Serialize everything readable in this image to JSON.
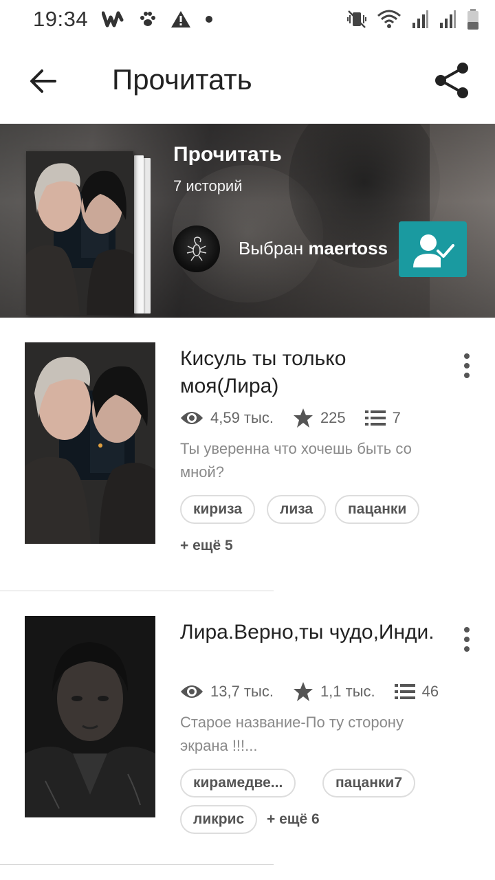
{
  "status_bar": {
    "time": "19:34",
    "left_icons": [
      "wattpad-icon",
      "paw-icon",
      "warning-icon",
      "dot-icon"
    ],
    "right_icons": [
      "vibrate-icon",
      "wifi-icon",
      "signal-icon",
      "signal-icon",
      "battery-icon"
    ]
  },
  "app_bar": {
    "title": "Прочитать"
  },
  "header": {
    "list_title": "Прочитать",
    "story_count": "7 историй",
    "curated_prefix": "Выбран",
    "curator": "maertoss",
    "accent_color": "#1a9aa0"
  },
  "stories": [
    {
      "title": "Кисуль ты только моя(Лира)",
      "reads": "4,59 тыс.",
      "votes": "225",
      "parts": "7",
      "description": "Ты уверенна что хочешь быть со мной?",
      "tags": [
        "кириза",
        "лиза",
        "пацанки"
      ],
      "more_tags": "+ ещё 5"
    },
    {
      "title": "Лира.Верно,ты чудо,Инди.",
      "reads": "13,7 тыс.",
      "votes": "1,1 тыс.",
      "parts": "46",
      "description": "Старое название-По ту сторону экрана !!!...",
      "tags": [
        "кирамедве...",
        "пацанки7",
        "ликрис"
      ],
      "more_tags": "+ ещё 6"
    }
  ]
}
